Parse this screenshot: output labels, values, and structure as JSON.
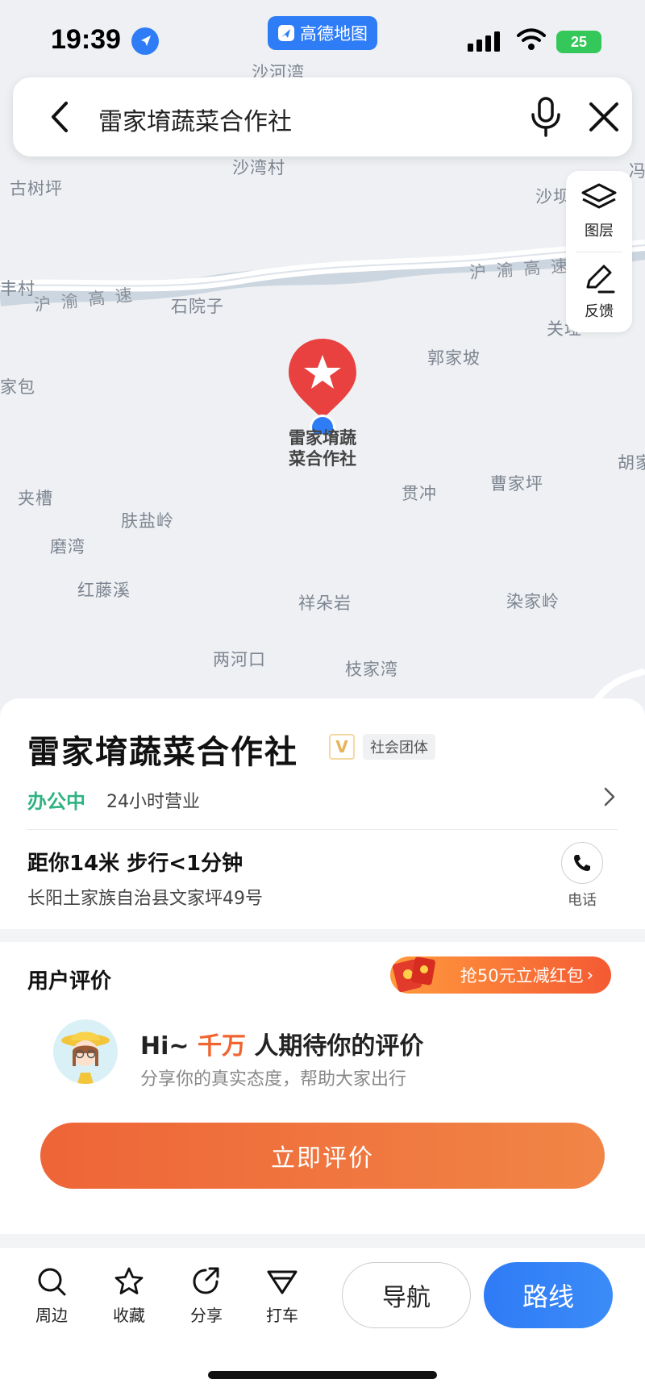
{
  "status_bar": {
    "time": "19:39",
    "app_name": "高德地图",
    "battery": "25"
  },
  "search": {
    "query": "雷家堉蔬菜合作社"
  },
  "map": {
    "places": [
      "沙河湾",
      "沙湾村",
      "古树坪",
      "沙坝",
      "石院子",
      "关垭",
      "郭家坡",
      "家包",
      "夹槽",
      "肤盐岭",
      "贯冲",
      "曹家坪",
      "胡家",
      "磨湾",
      "红藤溪",
      "祥朵岩",
      "染家岭",
      "两河口",
      "枝家湾",
      "丰村",
      "冯"
    ],
    "highway_left": "沪 渝 高 速",
    "highway_right": "沪 渝 高 速",
    "marker_label_line1": "雷家堉蔬",
    "marker_label_line2": "菜合作社"
  },
  "map_tools": {
    "layers_label": "图层",
    "feedback_label": "反馈"
  },
  "poi": {
    "title": "雷家堉蔬菜合作社",
    "verified_mark": "V",
    "category": "社会团体",
    "status": "办公中",
    "hours": "24小时营业",
    "distance": "距你14米  步行<1分钟",
    "address": "长阳土家族自治县文家坪49号",
    "phone_label": "电话"
  },
  "reviews": {
    "title": "用户评价",
    "promo": "抢50元立减红包",
    "prompt_prefix": "Hi~ ",
    "prompt_highlight": "千万",
    "prompt_suffix": " 人期待你的评价",
    "subtitle": "分享你的真实态度，帮助大家出行",
    "rate_button": "立即评价"
  },
  "toolbar": {
    "nearby": "周边",
    "favorite": "收藏",
    "share": "分享",
    "taxi": "打车",
    "navigate": "导航",
    "route": "路线"
  },
  "colors": {
    "accent_blue": "#2f7df6",
    "accent_orange": "#f06430",
    "open_green": "#2fb383",
    "marker_red": "#e8413f"
  }
}
